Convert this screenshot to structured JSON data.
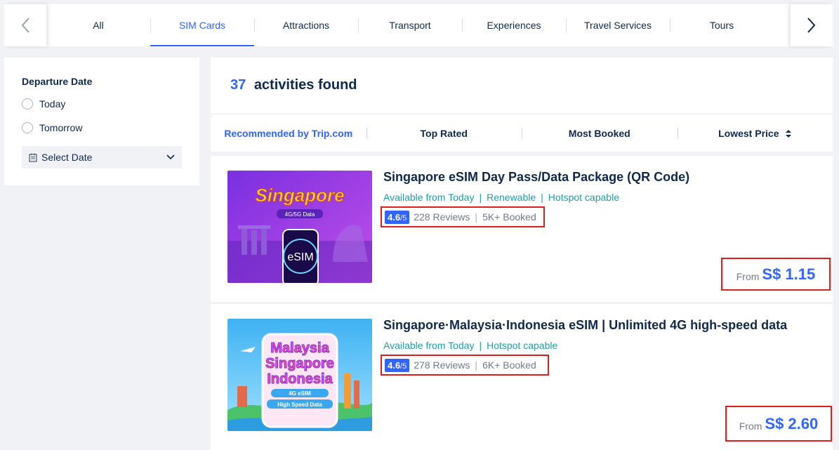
{
  "tabs": [
    "All",
    "SIM Cards",
    "Attractions",
    "Transport",
    "Experiences",
    "Travel Services",
    "Tours"
  ],
  "active_tab": "SIM Cards",
  "filters": {
    "departure_title": "Departure Date",
    "options": [
      "Today",
      "Tomorrow"
    ],
    "select_date": "Select Date"
  },
  "results": {
    "count": "37",
    "count_label": "activities found"
  },
  "sort": {
    "recommended": "Recommended by Trip.com",
    "top_rated": "Top Rated",
    "most_booked": "Most Booked",
    "lowest_price": "Lowest Price"
  },
  "products": [
    {
      "title": "Singapore eSIM Day Pass/Data Package (QR Code)",
      "tags": [
        "Available from Today",
        "Renewable",
        "Hotspot capable"
      ],
      "score": "4.6",
      "score_out_of": "/5",
      "reviews": "228 Reviews",
      "booked": "5K+ Booked",
      "price_prefix": "From",
      "price": "S$ 1.15",
      "image_text": "Singapore",
      "image_subtext": "4G/5G Data",
      "image_badge": "eSIM"
    },
    {
      "title": "Singapore·Malaysia·Indonesia eSIM | Unlimited 4G high-speed data",
      "tags": [
        "Available from Today",
        "Hotspot capable"
      ],
      "score": "4.6",
      "score_out_of": "/5",
      "reviews": "278 Reviews",
      "booked": "6K+ Booked",
      "price_prefix": "From",
      "price": "S$ 2.60",
      "image_lines": [
        "Malaysia",
        "Singapore",
        "Indonesia"
      ],
      "image_badge": "4G eSIM",
      "image_badge2": "High Speed Data"
    }
  ],
  "colors": {
    "accent": "#3264ff",
    "tag": "#1f9ea7",
    "highlight_box": "#e31c1c"
  }
}
